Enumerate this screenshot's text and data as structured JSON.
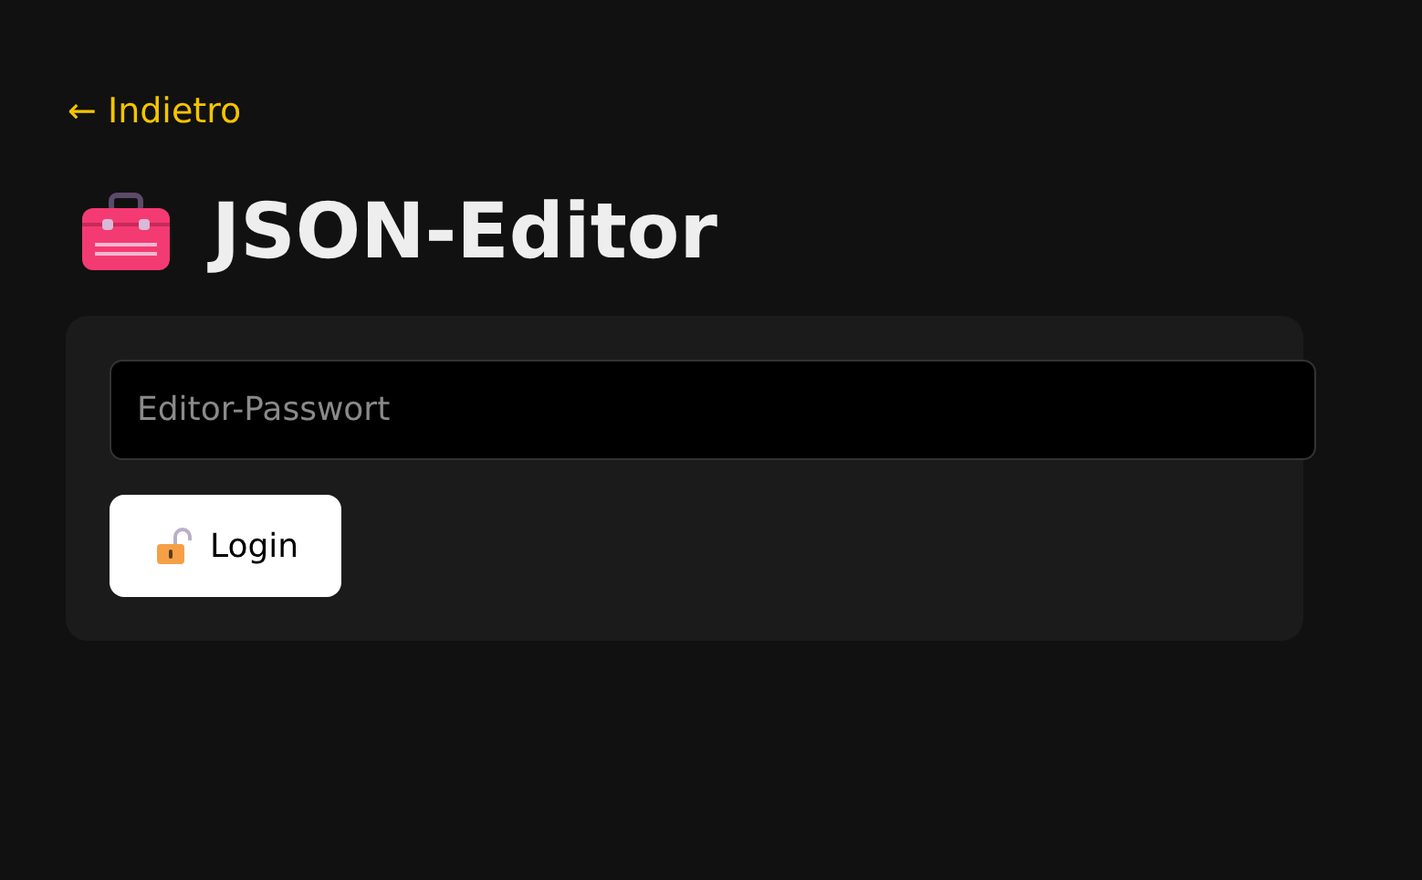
{
  "back_link": {
    "label": "← Indietro"
  },
  "title": {
    "text": "JSON-Editor"
  },
  "login_form": {
    "password_field": {
      "placeholder": "Editor-Passwort"
    },
    "login_button": {
      "label": "Login"
    }
  }
}
